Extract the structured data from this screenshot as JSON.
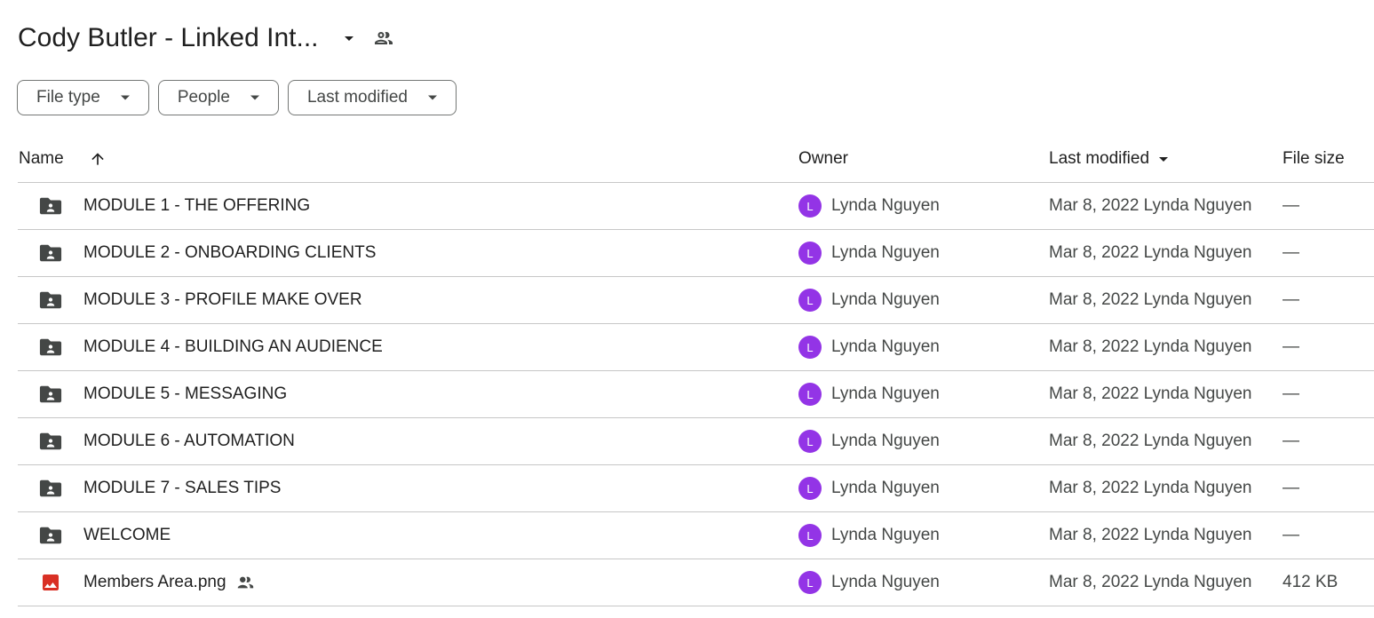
{
  "header": {
    "title": "Cody Butler - Linked Int...",
    "title_caret_icon": "arrow-drop-down-icon",
    "shared_icon": "people-icon"
  },
  "filters": [
    {
      "label": "File type"
    },
    {
      "label": "People"
    },
    {
      "label": "Last modified"
    }
  ],
  "columns": {
    "name": "Name",
    "owner": "Owner",
    "last_modified": "Last modified",
    "file_size": "File size",
    "name_sort_icon": "arrow-upward-icon",
    "modified_sort_icon": "arrow-drop-down-icon"
  },
  "colors": {
    "folder_icon": "#444746",
    "image_icon": "#d93025",
    "avatar": "#9334e6",
    "divider": "#c7c7c7"
  },
  "rows": [
    {
      "name": "MODULE 1 - THE OFFERING",
      "type": "shared-folder",
      "avatar": "L",
      "owner": "Lynda Nguyen",
      "modified": "Mar 8, 2022 Lynda Nguyen",
      "size": "—",
      "shared": false
    },
    {
      "name": "MODULE 2 - ONBOARDING CLIENTS",
      "type": "shared-folder",
      "avatar": "L",
      "owner": "Lynda Nguyen",
      "modified": "Mar 8, 2022 Lynda Nguyen",
      "size": "—",
      "shared": false
    },
    {
      "name": "MODULE 3 - PROFILE MAKE OVER",
      "type": "shared-folder",
      "avatar": "L",
      "owner": "Lynda Nguyen",
      "modified": "Mar 8, 2022 Lynda Nguyen",
      "size": "—",
      "shared": false
    },
    {
      "name": "MODULE 4 - BUILDING AN AUDIENCE",
      "type": "shared-folder",
      "avatar": "L",
      "owner": "Lynda Nguyen",
      "modified": "Mar 8, 2022 Lynda Nguyen",
      "size": "—",
      "shared": false
    },
    {
      "name": "MODULE 5 - MESSAGING",
      "type": "shared-folder",
      "avatar": "L",
      "owner": "Lynda Nguyen",
      "modified": "Mar 8, 2022 Lynda Nguyen",
      "size": "—",
      "shared": false
    },
    {
      "name": "MODULE 6 - AUTOMATION",
      "type": "shared-folder",
      "avatar": "L",
      "owner": "Lynda Nguyen",
      "modified": "Mar 8, 2022 Lynda Nguyen",
      "size": "—",
      "shared": false
    },
    {
      "name": "MODULE 7 - SALES TIPS",
      "type": "shared-folder",
      "avatar": "L",
      "owner": "Lynda Nguyen",
      "modified": "Mar 8, 2022 Lynda Nguyen",
      "size": "—",
      "shared": false
    },
    {
      "name": "WELCOME",
      "type": "shared-folder",
      "avatar": "L",
      "owner": "Lynda Nguyen",
      "modified": "Mar 8, 2022 Lynda Nguyen",
      "size": "—",
      "shared": false
    },
    {
      "name": "Members Area.png",
      "type": "image",
      "avatar": "L",
      "owner": "Lynda Nguyen",
      "modified": "Mar 8, 2022 Lynda Nguyen",
      "size": "412 KB",
      "shared": true
    }
  ]
}
